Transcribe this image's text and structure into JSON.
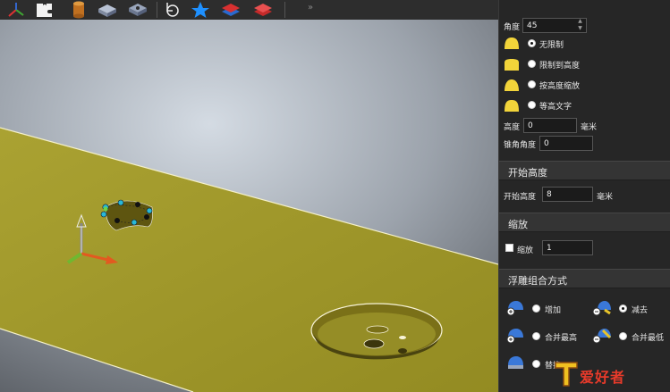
{
  "toolbar": {
    "icons": [
      "axis-icon",
      "puzzle-icon",
      "cylinder-icon",
      "box-icon",
      "box-outline-icon",
      "rotate-icon",
      "star-icon",
      "layers-blue-icon",
      "layers-red-icon"
    ]
  },
  "panel": {
    "angle_label": "角度",
    "angle_value": "45",
    "options": {
      "unlimited": "无限制",
      "limit_height": "限制到高度",
      "scale_height": "按高度缩放",
      "equal_text": "等高文字"
    },
    "height_label": "高度",
    "height_value": "0",
    "height_unit": "毫米",
    "draft_label": "锥角角度",
    "draft_value": "0"
  },
  "start_height": {
    "title": "开始高度",
    "label": "开始高度",
    "value": "8",
    "unit": "毫米"
  },
  "scale": {
    "title": "缩放",
    "label": "缩放",
    "value": "1"
  },
  "relief": {
    "title": "浮雕组合方式",
    "add": "增加",
    "subtract": "减去",
    "merge_high": "合并最高",
    "merge_low": "合并最低",
    "replace": "替换"
  },
  "watermark": {
    "text": "爱好者"
  },
  "colors": {
    "surface": "#9c9428",
    "accent_yellow": "#f2d43a",
    "panel_bg": "#262626",
    "handle": "#29b8d8"
  }
}
